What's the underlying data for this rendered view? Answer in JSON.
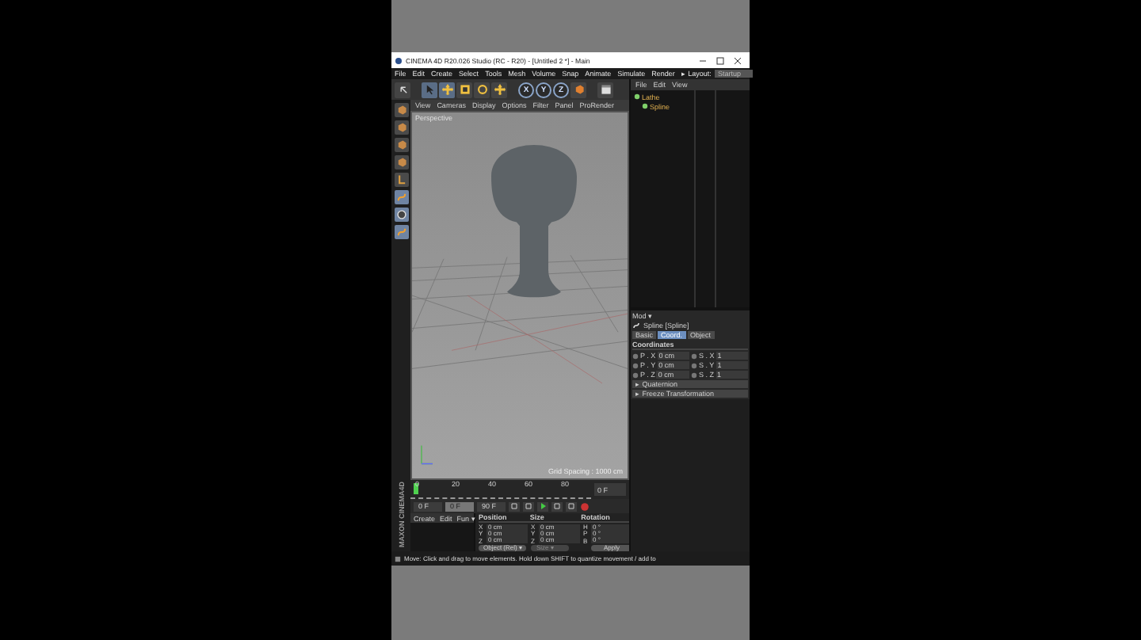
{
  "window": {
    "title": "CINEMA 4D R20.026 Studio (RC - R20) - [Untitled 2 *] - Main"
  },
  "menu_bar": [
    "File",
    "Edit",
    "Create",
    "Select",
    "Tools",
    "Mesh",
    "Volume",
    "Snap",
    "Animate",
    "Simulate",
    "Render"
  ],
  "layout": {
    "label": "▸ Layout:",
    "value": "Startup"
  },
  "axis_buttons": [
    "X",
    "Y",
    "Z"
  ],
  "viewport": {
    "menu": [
      "View",
      "Cameras",
      "Display",
      "Options",
      "Filter",
      "Panel",
      "ProRender"
    ],
    "camera": "Perspective",
    "grid_spacing": "Grid Spacing : 1000 cm"
  },
  "object_manager": {
    "menu": [
      "File",
      "Edit",
      "View"
    ],
    "objects": [
      {
        "name": "Lathe",
        "children": [
          {
            "name": "Spline"
          }
        ]
      }
    ]
  },
  "attribute_manager": {
    "mode": "Mod ▾",
    "object_label": "Spline [Spline]",
    "tabs": [
      {
        "label": "Basic",
        "selected": false
      },
      {
        "label": "Coord.",
        "selected": true
      },
      {
        "label": "Object",
        "selected": false
      }
    ],
    "section": "Coordinates",
    "fields": [
      {
        "label": "P . X",
        "value": "0 cm"
      },
      {
        "label": "S . X",
        "value": "1"
      },
      {
        "label": "P . Y",
        "value": "0 cm"
      },
      {
        "label": "S . Y",
        "value": "1"
      },
      {
        "label": "P . Z",
        "value": "0 cm"
      },
      {
        "label": "S . Z",
        "value": "1"
      }
    ],
    "groups": [
      "▸ Quaternion",
      "▸ Freeze Transformation"
    ]
  },
  "timeline": {
    "ticks": [
      "0",
      "20",
      "40",
      "60",
      "80"
    ],
    "end_field": "0 F"
  },
  "playback": {
    "start": "0 F",
    "current": "0 F",
    "end": "90 F"
  },
  "material_manager": {
    "menu": [
      "Create",
      "Edit",
      "Fun ▾"
    ]
  },
  "coordinates": {
    "headers": [
      "Position",
      "Size",
      "Rotation"
    ],
    "rows": [
      [
        "X",
        "0 cm",
        "X",
        "0 cm",
        "H",
        "0 °"
      ],
      [
        "Y",
        "0 cm",
        "Y",
        "0 cm",
        "P",
        "0 °"
      ],
      [
        "Z",
        "0 cm",
        "Z",
        "0 cm",
        "B",
        "0 °"
      ]
    ],
    "mode": "Object (Rel) ▾",
    "size_mode": "Size ▾",
    "apply": "Apply"
  },
  "logo": "MAXON CINEMA4D",
  "status_bar": "Move: Click and drag to move elements. Hold down SHIFT to quantize movement / add to"
}
